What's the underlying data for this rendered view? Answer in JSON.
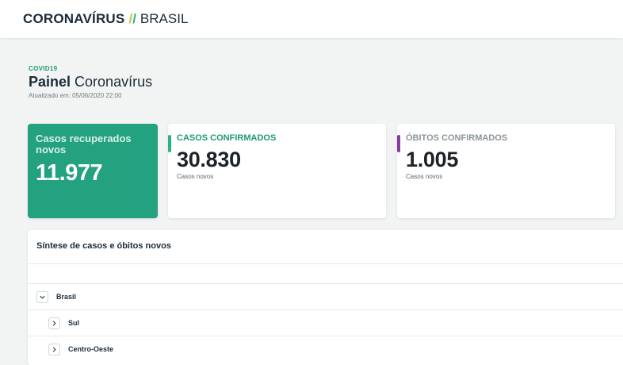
{
  "header": {
    "brand_main": "CORONAVÍRUS",
    "brand_sub": "BRASIL",
    "colors": {
      "slash1": "#c9c33a",
      "slash2": "#2bb08a"
    }
  },
  "page": {
    "kicker": "COVID19",
    "title_bold": "Painel",
    "title_rest": "Coronavírus",
    "updated_label": "Atualizado em:",
    "updated_value": "05/06/2020 22:00"
  },
  "cards": {
    "recovered": {
      "label": "Casos recuperados novos",
      "value": "11.977",
      "color": "#24a17e"
    },
    "confirmed": {
      "label": "CASOS CONFIRMADOS",
      "value": "30.830",
      "sub": "Casos novos",
      "accent": "#2bb08a"
    },
    "deaths": {
      "label": "ÓBITOS CONFIRMADOS",
      "value": "1.005",
      "sub": "Casos novos",
      "accent": "#8a3a9c"
    }
  },
  "synthesis": {
    "title": "Síntese de casos e óbitos novos",
    "rows": [
      {
        "label": "Brasil",
        "icon": "chevron-down-icon"
      },
      {
        "label": "Sul",
        "icon": "chevron-right-icon"
      },
      {
        "label": "Centro-Oeste",
        "icon": "chevron-right-icon"
      }
    ]
  }
}
